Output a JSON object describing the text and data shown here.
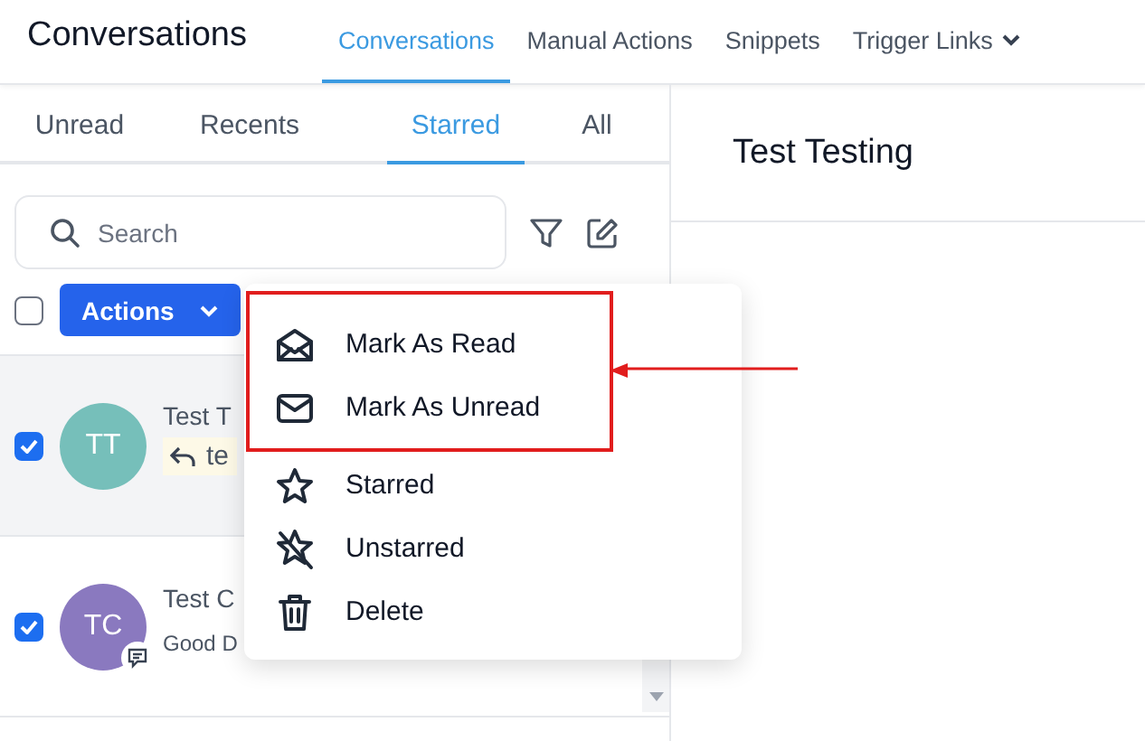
{
  "header": {
    "title": "Conversations",
    "nav": [
      {
        "label": "Conversations",
        "selected": true
      },
      {
        "label": "Manual Actions",
        "selected": false
      },
      {
        "label": "Snippets",
        "selected": false
      },
      {
        "label": "Trigger Links",
        "selected": false,
        "dropdown": true
      }
    ]
  },
  "filter_tabs": [
    {
      "label": "Unread",
      "selected": false
    },
    {
      "label": "Recents",
      "selected": false
    },
    {
      "label": "Starred",
      "selected": true
    },
    {
      "label": "All",
      "selected": false
    }
  ],
  "search": {
    "placeholder": "Search"
  },
  "select_all": {
    "checked": false
  },
  "actions_button": {
    "label": "Actions"
  },
  "conversations": [
    {
      "initials": "TT",
      "color": "#76bfba",
      "name": "Test T",
      "preview": "te",
      "kind": "reply",
      "checked": true,
      "selected": true
    },
    {
      "initials": "TC",
      "color": "#8a79bf",
      "name": "Test C",
      "preview": "Good D",
      "kind": "chat",
      "checked": true,
      "selected": false
    }
  ],
  "detail": {
    "title": "Test Testing"
  },
  "menu": [
    {
      "kind": "read",
      "label": "Mark As Read",
      "highlighted": true
    },
    {
      "kind": "unread",
      "label": "Mark As Unread",
      "highlighted": true
    },
    {
      "kind": "star",
      "label": "Starred",
      "highlighted": false
    },
    {
      "kind": "unstar",
      "label": "Unstarred",
      "highlighted": false
    },
    {
      "kind": "delete",
      "label": "Delete",
      "highlighted": false
    }
  ]
}
